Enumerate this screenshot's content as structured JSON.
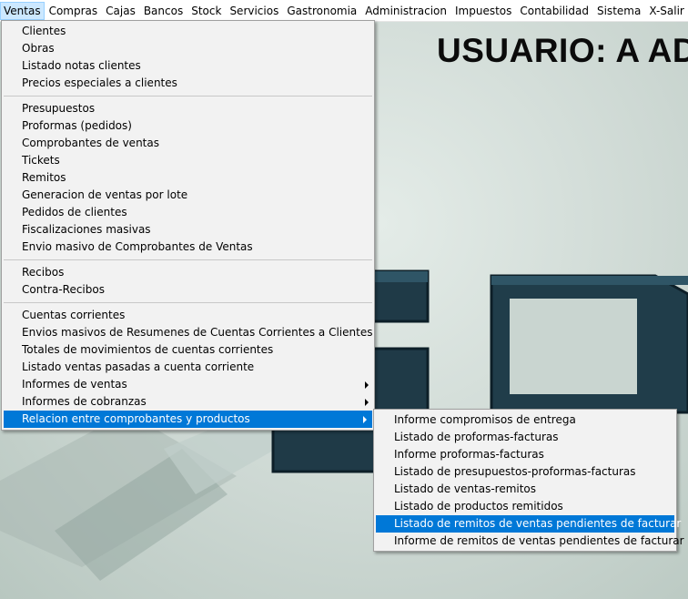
{
  "menubar": {
    "items": [
      "Ventas",
      "Compras",
      "Cajas",
      "Bancos",
      "Stock",
      "Servicios",
      "Gastronomia",
      "Administracion",
      "Impuestos",
      "Contabilidad",
      "Sistema",
      "X-Salir"
    ]
  },
  "background": {
    "user_title": "USUARIO: A AD"
  },
  "ventas_menu": {
    "group1": [
      "Clientes",
      "Obras",
      "Listado notas clientes",
      "Precios especiales a clientes"
    ],
    "group2": [
      "Presupuestos",
      "Proformas (pedidos)",
      "Comprobantes de ventas",
      "Tickets",
      "Remitos",
      "Generacion de ventas por lote",
      "Pedidos de clientes",
      "Fiscalizaciones masivas",
      "Envio masivo de Comprobantes de Ventas"
    ],
    "group3": [
      "Recibos",
      "Contra-Recibos"
    ],
    "group4": [
      "Cuentas corrientes",
      "Envios masivos de Resumenes de Cuentas Corrientes a Clientes",
      "Totales de movimientos de cuentas corrientes",
      "Listado ventas pasadas a cuenta corriente",
      "Informes de ventas",
      "Informes de cobranzas",
      "Relacion entre comprobantes y productos"
    ]
  },
  "submenu": {
    "items": [
      "Informe compromisos de entrega",
      "Listado de proformas-facturas",
      "Informe proformas-facturas",
      "Listado de presupuestos-proformas-facturas",
      "Listado de ventas-remitos",
      "Listado de productos remitidos",
      "Listado de remitos de ventas pendientes de facturar",
      "Informe de remitos de ventas pendientes de facturar"
    ]
  },
  "colors": {
    "highlight": "#0078d7",
    "menubar_active": "#cce8ff",
    "menu_bg": "#f2f2f2",
    "logo": "#1f3a47"
  },
  "icons": {
    "submenu_arrow": "chevron-right-icon"
  }
}
